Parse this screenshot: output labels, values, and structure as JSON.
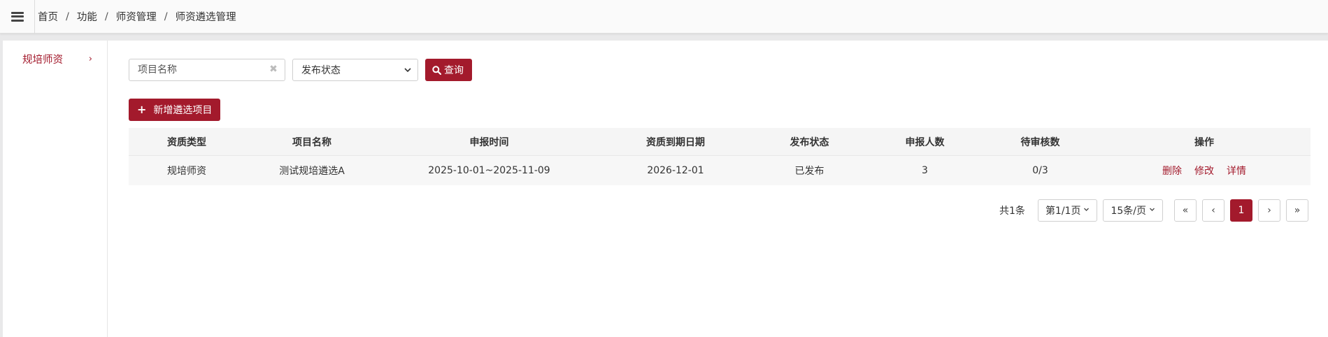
{
  "breadcrumb": [
    "首页",
    "功能",
    "师资管理",
    "师资遴选管理"
  ],
  "breadcrumb_separator": "/",
  "sidebar": {
    "items": [
      {
        "label": "规培师资",
        "active": true
      }
    ]
  },
  "filters": {
    "name_placeholder": "项目名称",
    "status_selected": "发布状态",
    "query_label": "查询"
  },
  "add_button_label": "新增遴选项目",
  "table": {
    "headers": [
      "资质类型",
      "项目名称",
      "申报时间",
      "资质到期日期",
      "发布状态",
      "申报人数",
      "待审核数",
      "操作"
    ],
    "rows": [
      {
        "type": "规培师资",
        "name": "测试规培遴选A",
        "apply_time": "2025-10-01~2025-11-09",
        "expire_date": "2026-12-01",
        "status": "已发布",
        "applicants": "3",
        "pending": "0/3",
        "actions": [
          "删除",
          "修改",
          "详情"
        ]
      }
    ]
  },
  "pagination": {
    "total": "共1条",
    "page_info": "第1/1页",
    "page_size": "15条/页",
    "first": "«",
    "prev": "‹",
    "current": "1",
    "next": "›",
    "last": "»"
  },
  "colors": {
    "accent": "#a31a2c"
  },
  "icons": {
    "menu": "hamburger-icon",
    "clear": "clear-icon",
    "dropdown": "chevron-down-icon",
    "search": "search-icon",
    "add": "plus-icon",
    "sidebar_arrow": "chevron-right-icon"
  }
}
